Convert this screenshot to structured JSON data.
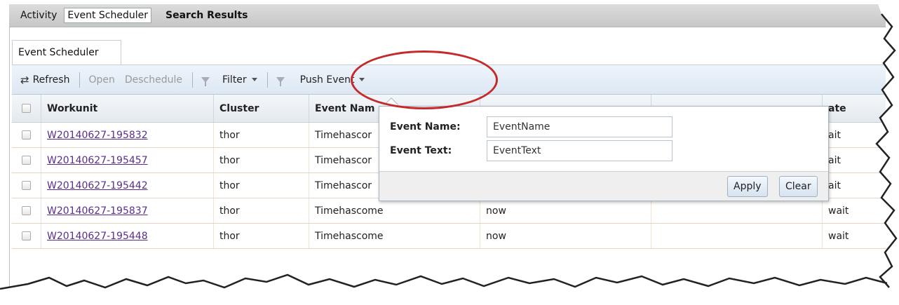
{
  "top_tabs": [
    {
      "label": "Activity"
    },
    {
      "label": "Event Scheduler"
    },
    {
      "label": "Search Results"
    }
  ],
  "sub_tab": {
    "label": "Event Scheduler"
  },
  "toolbar": {
    "refresh_label": "Refresh",
    "open_label": "Open",
    "deschedule_label": "Deschedule",
    "filter_label": "Filter",
    "push_event_label": "Push Event"
  },
  "grid": {
    "headers": [
      "Workunit",
      "Cluster",
      "Event Nam",
      "ate"
    ],
    "rows": [
      {
        "workunit": "W20140627-195832",
        "cluster": "thor",
        "event_name": "Timehascor",
        "event_text": "",
        "state": "ait"
      },
      {
        "workunit": "W20140627-195457",
        "cluster": "thor",
        "event_name": "Timehascor",
        "event_text": "",
        "state": "ait"
      },
      {
        "workunit": "W20140627-195442",
        "cluster": "thor",
        "event_name": "Timehascor",
        "event_text": "",
        "state": "ait"
      },
      {
        "workunit": "W20140627-195837",
        "cluster": "thor",
        "event_name": "Timehascome",
        "event_text": "now",
        "state": "wait"
      },
      {
        "workunit": "W20140627-195448",
        "cluster": "thor",
        "event_name": "Timehascome",
        "event_text": "now",
        "state": "wait"
      }
    ]
  },
  "push_event_popup": {
    "event_name_label": "Event Name:",
    "event_name_value": "EventName",
    "event_text_label": "Event Text:",
    "event_text_value": "EventText",
    "apply_label": "Apply",
    "clear_label": "Clear"
  },
  "colors": {
    "highlight": "#c42a2a",
    "link": "#5a2d8c",
    "toolbar_bg": "#dde8f3"
  }
}
